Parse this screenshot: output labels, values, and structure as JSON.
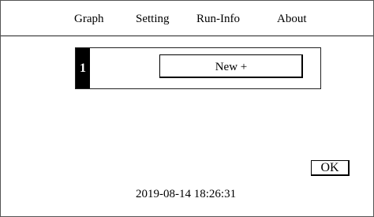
{
  "menu": {
    "graph": "Graph",
    "setting": "Setting",
    "runinfo": "Run-Info",
    "about": "About"
  },
  "slot": {
    "number": "1",
    "new_label": "New +"
  },
  "dialog": {
    "ok_label": "OK"
  },
  "status": {
    "timestamp": "2019-08-14 18:26:31"
  },
  "colors": {
    "foreground": "#000000",
    "background": "#ffffff",
    "slot_number_bg": "#000000",
    "slot_number_text": "#ffffff"
  }
}
